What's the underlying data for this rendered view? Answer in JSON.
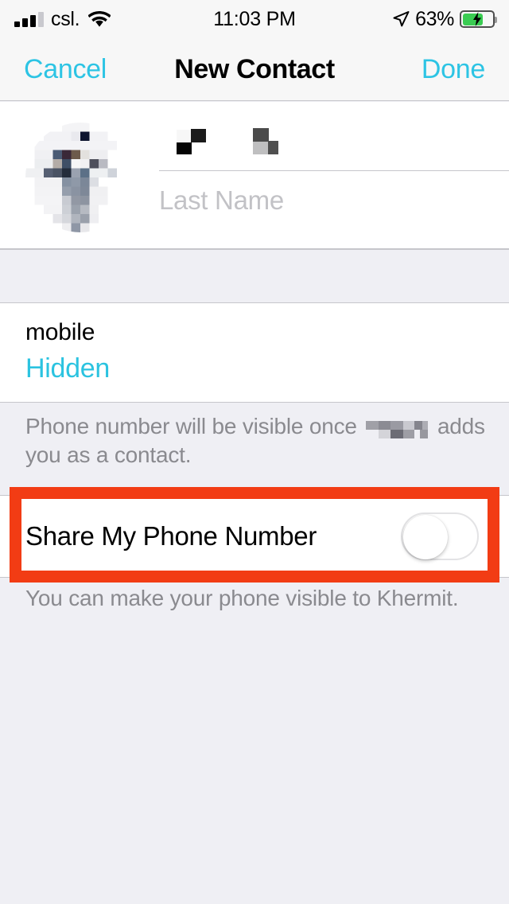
{
  "status_bar": {
    "carrier": "csl.",
    "time": "11:03 PM",
    "battery_percent": "63%",
    "battery_level": 63,
    "battery_charging": true,
    "signal_bars_filled": 3,
    "signal_bars_total": 4,
    "wifi_icon": "wifi-icon",
    "location_icon": "location-arrow-icon",
    "battery_icon": "battery-charging-icon"
  },
  "nav": {
    "cancel_label": "Cancel",
    "title": "New Contact",
    "done_label": "Done",
    "tint_color": "#2DC4E4"
  },
  "contact": {
    "avatar_name": "contact-photo-redacted",
    "first_name_value": "",
    "first_name_redacted": true,
    "last_name_placeholder": "Last Name",
    "last_name_value": ""
  },
  "phone_section": {
    "label": "mobile",
    "value": "Hidden",
    "value_color": "#2BC3E0",
    "footnote_prefix": "Phone number will be visible once",
    "footnote_suffix": "adds you as a contact.",
    "footnote_name_redacted": true
  },
  "share_row": {
    "label": "Share My Phone Number",
    "toggle_on": false,
    "footnote": "You can make your phone visible to Khermit."
  },
  "annotation": {
    "type": "highlight-box",
    "color": "#F23C14",
    "target": "share-my-phone-number-row"
  }
}
